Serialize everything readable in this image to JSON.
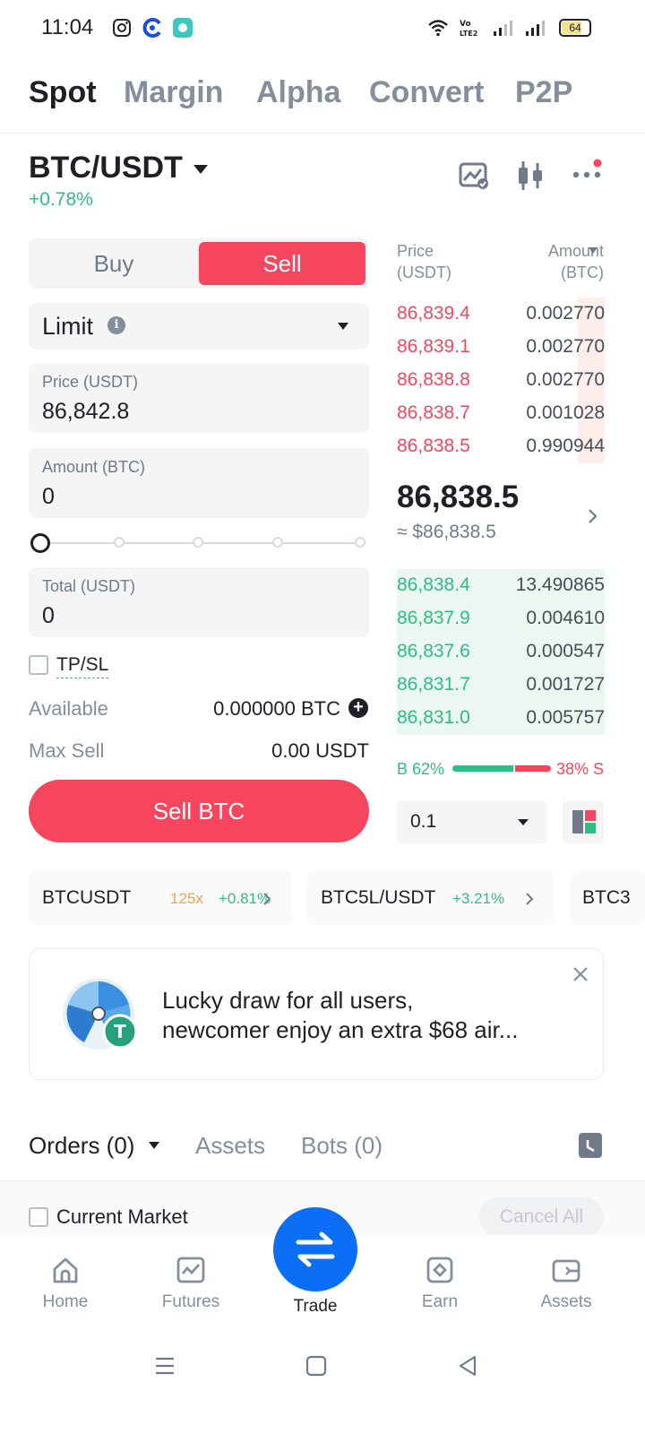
{
  "status_bar": {
    "time": "11:04",
    "battery": "64",
    "icons": [
      "instagram-icon",
      "browser-icon",
      "chat-app-icon",
      "wifi-icon",
      "volte-icon",
      "signal-icon",
      "signal-icon",
      "battery-icon"
    ]
  },
  "top_tabs": [
    "Spot",
    "Margin",
    "Alpha",
    "Convert",
    "P2P"
  ],
  "pair": {
    "name": "BTC/USDT",
    "change": "+0.78%"
  },
  "header_icons": [
    "chart-icon",
    "candlestick-icon",
    "more-icon"
  ],
  "order_form": {
    "buy_label": "Buy",
    "sell_label": "Sell",
    "order_type": "Limit",
    "price_label": "Price (USDT)",
    "price_value": "86,842.8",
    "amount_label": "Amount (BTC)",
    "amount_value": "0",
    "slider_percent": 0,
    "total_label": "Total (USDT)",
    "total_value": "0",
    "tpsl_label": "TP/SL",
    "available_label": "Available",
    "available_value": "0.000000 BTC",
    "max_sell_label": "Max Sell",
    "max_sell_value": "0.00 USDT",
    "submit_label": "Sell BTC"
  },
  "order_book": {
    "price_header": "Price",
    "price_unit": "(USDT)",
    "amount_header": "Amount",
    "amount_unit": "(BTC)",
    "asks": [
      {
        "price": "86,839.4",
        "amount": "0.002770"
      },
      {
        "price": "86,839.1",
        "amount": "0.002770"
      },
      {
        "price": "86,838.8",
        "amount": "0.002770"
      },
      {
        "price": "86,838.7",
        "amount": "0.001028"
      },
      {
        "price": "86,838.5",
        "amount": "0.990944"
      }
    ],
    "last_price": "86,838.5",
    "last_price_usd": "≈ $86,838.5",
    "bids": [
      {
        "price": "86,838.4",
        "amount": "13.490865"
      },
      {
        "price": "86,837.9",
        "amount": "0.004610"
      },
      {
        "price": "86,837.6",
        "amount": "0.000547"
      },
      {
        "price": "86,831.7",
        "amount": "0.001727"
      },
      {
        "price": "86,831.0",
        "amount": "0.005757"
      }
    ],
    "buy_ratio": "B 62%",
    "sell_ratio": "38% S",
    "buy_ratio_value": 62,
    "precision": "0.1"
  },
  "tickers": [
    {
      "symbol": "BTCUSDT",
      "leverage": "125x",
      "change": "+0.81%"
    },
    {
      "symbol": "BTC5L/USDT",
      "change": "+3.21%"
    },
    {
      "symbol": "BTC3"
    }
  ],
  "promo": {
    "line1": "Lucky draw for all users,",
    "line2": "newcomer enjoy an extra $68 air..."
  },
  "orders_tabs": {
    "orders": "Orders (0)",
    "assets": "Assets",
    "bots": "Bots (0)"
  },
  "current_market_label": "Current Market",
  "cancel_all_label": "Cancel All",
  "bottom_nav": [
    "Home",
    "Futures",
    "Trade",
    "Earn",
    "Assets"
  ],
  "colors": {
    "sell": "#f6465d",
    "buy": "#2ebd85",
    "trade_button": "#0b6ef7",
    "leverage": "#f0a34b"
  }
}
